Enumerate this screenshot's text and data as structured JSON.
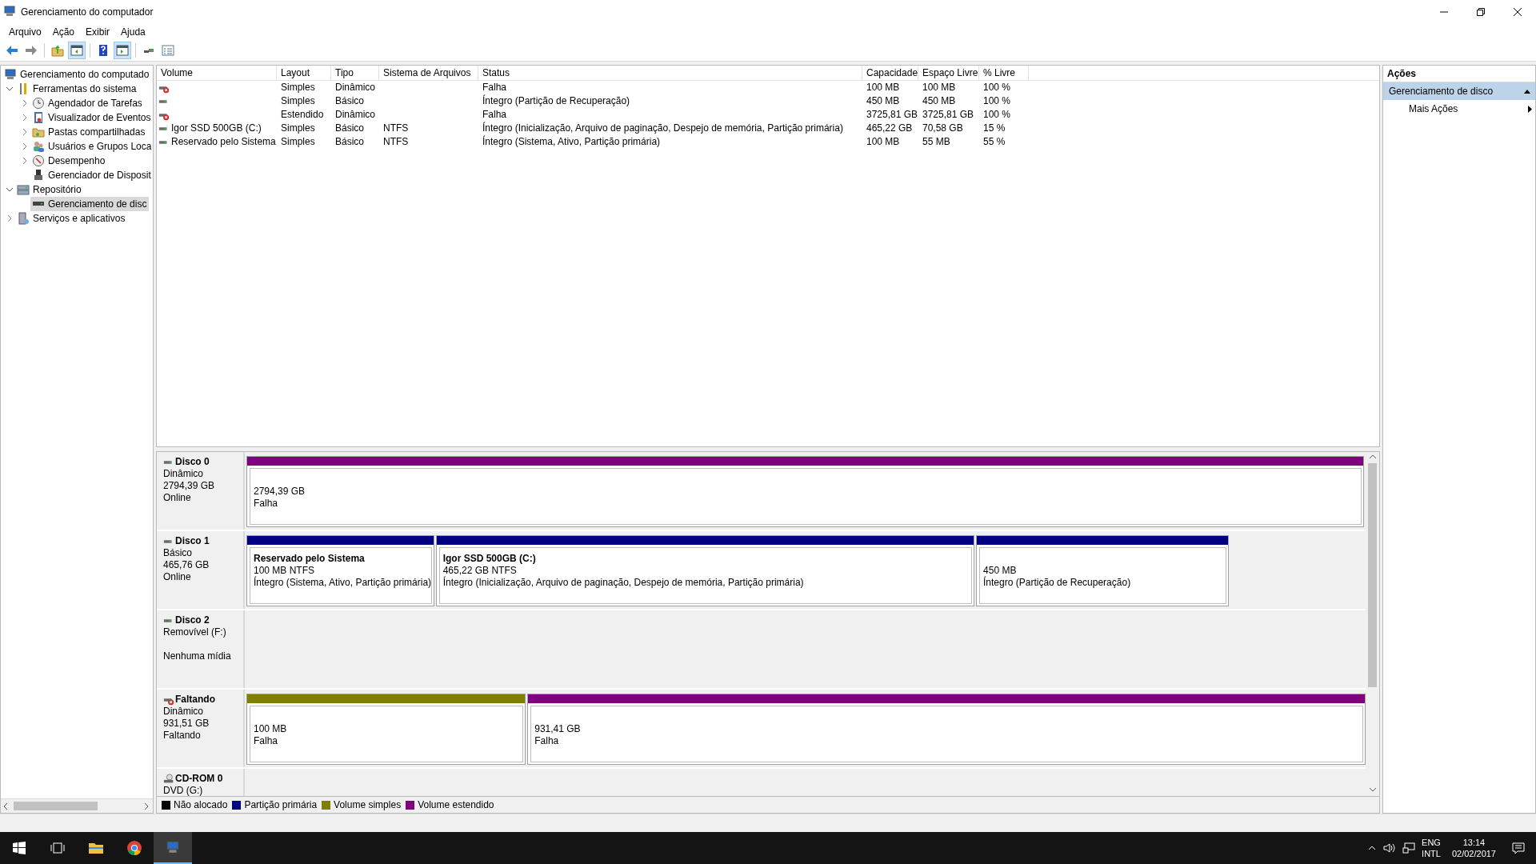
{
  "window": {
    "title": "Gerenciamento do computador"
  },
  "menu": [
    {
      "label": "Arquivo"
    },
    {
      "label": "Ação"
    },
    {
      "label": "Exibir"
    },
    {
      "label": "Ajuda"
    }
  ],
  "toolbar": [
    {
      "kind": "back",
      "pressed": false
    },
    {
      "kind": "forward",
      "pressed": false
    },
    {
      "kind": "up",
      "pressed": false
    },
    {
      "kind": "tree_pane",
      "pressed": true
    },
    {
      "kind": "help",
      "pressed": false
    },
    {
      "kind": "action_pane",
      "pressed": true
    },
    {
      "kind": "connect",
      "pressed": false
    },
    {
      "kind": "properties",
      "pressed": false
    }
  ],
  "tree": [
    {
      "label": "Gerenciamento do computado",
      "selected": false,
      "children": [
        {
          "label": "Ferramentas do sistema",
          "expanded": true,
          "selected": false,
          "children": [
            {
              "label": "Agendador de Tarefas",
              "expanded": false,
              "selected": false
            },
            {
              "label": "Visualizador de Eventos",
              "expanded": false,
              "selected": false
            },
            {
              "label": "Pastas compartilhadas",
              "expanded": false,
              "selected": false
            },
            {
              "label": "Usuários e Grupos Loca",
              "expanded": false,
              "selected": false
            },
            {
              "label": "Desempenho",
              "expanded": false,
              "selected": false
            },
            {
              "label": "Gerenciador de Disposit",
              "selected": false
            }
          ]
        },
        {
          "label": "Repositório",
          "expanded": true,
          "selected": false,
          "children": [
            {
              "label": "Gerenciamento de disc",
              "selected": true
            }
          ]
        },
        {
          "label": "Serviços e aplicativos",
          "expanded": false,
          "selected": false
        }
      ]
    }
  ],
  "volumes": {
    "columns": [
      "Volume",
      "Layout",
      "Tipo",
      "Sistema de Arquivos",
      "Status",
      "Capacidade",
      "Espaço Livre",
      "% Livre"
    ],
    "rows": [
      {
        "error": true,
        "layout": "Simples",
        "type": "Dinâmico",
        "status": "Falha",
        "capacity": "100 MB",
        "free": "100 MB",
        "pct": "100 %"
      },
      {
        "error": false,
        "layout": "Simples",
        "type": "Básico",
        "status": "Íntegro (Partição de Recuperação)",
        "capacity": "450 MB",
        "free": "450 MB",
        "pct": "100 %"
      },
      {
        "error": true,
        "layout": "Estendido",
        "type": "Dinâmico",
        "status": "Falha",
        "capacity": "3725,81 GB",
        "free": "3725,81 GB",
        "pct": "100 %"
      },
      {
        "error": false,
        "volume": "Igor SSD 500GB (C:)",
        "layout": "Simples",
        "type": "Básico",
        "fs": "NTFS",
        "status": "Íntegro (Inicialização, Arquivo de paginação, Despejo de memória, Partição primária)",
        "capacity": "465,22 GB",
        "free": "70,58 GB",
        "pct": "15 %"
      },
      {
        "error": false,
        "volume": "Reservado pelo Sistema",
        "layout": "Simples",
        "type": "Básico",
        "fs": "NTFS",
        "status": "Íntegro (Sistema, Ativo, Partição primária)",
        "capacity": "100 MB",
        "free": "55 MB",
        "pct": "55 %"
      }
    ]
  },
  "disks": [
    {
      "kind": "hdd",
      "name": "Disco 0",
      "type": "Dinâmico",
      "size": "2794,39 GB",
      "status": "Online",
      "partitions": [
        {
          "kind": "extended",
          "size": "2794,39 GB",
          "status": "Falha"
        }
      ]
    },
    {
      "kind": "hdd",
      "name": "Disco 1",
      "type": "Básico",
      "size": "465,76 GB",
      "status": "Online",
      "partitions": [
        {
          "kind": "primary",
          "name": "Reservado pelo Sistema",
          "size": "100 MB NTFS",
          "status": "Íntegro (Sistema, Ativo, Partição primária)"
        },
        {
          "kind": "primary",
          "name": "Igor SSD 500GB  (C:)",
          "size": "465,22 GB NTFS",
          "status": "Íntegro (Inicialização, Arquivo de paginação, Despejo de memória, Partição primária)"
        },
        {
          "kind": "primary",
          "size": "450 MB",
          "status": "Íntegro (Partição de Recuperação)"
        }
      ]
    },
    {
      "kind": "hdd",
      "name": "Disco 2",
      "type": "Removível (F:)",
      "status": "Nenhuma mídia"
    },
    {
      "kind": "missing",
      "name": "Faltando",
      "type": "Dinâmico",
      "size": "931,51 GB",
      "status": "Faltando",
      "partitions": [
        {
          "kind": "simple",
          "size": "100 MB",
          "status": "Falha"
        },
        {
          "kind": "extended",
          "size": "931,41 GB",
          "status": "Falha"
        }
      ]
    },
    {
      "kind": "cdrom",
      "name": "CD-ROM 0",
      "type": "DVD (G:)"
    }
  ],
  "legend": [
    {
      "label": "Não alocado",
      "color": "#000000"
    },
    {
      "label": "Partição primária",
      "color": "#000080"
    },
    {
      "label": "Volume simples",
      "color": "#808000"
    },
    {
      "label": "Volume estendido",
      "color": "#800080"
    }
  ],
  "actions": {
    "title": "Ações",
    "section": {
      "label": "Gerenciamento de disco",
      "expanded": true
    },
    "items": [
      {
        "label": "Mais Ações"
      }
    ]
  },
  "taskbar": {
    "apps": [
      {
        "kind": "start",
        "active": false
      },
      {
        "kind": "taskview",
        "active": false
      },
      {
        "kind": "explorer",
        "active": false
      },
      {
        "kind": "browser",
        "active": false
      },
      {
        "kind": "compmgmt",
        "active": true
      }
    ],
    "language": [
      "ENG",
      "INTL"
    ],
    "time": "13:14",
    "date": "02/02/2017"
  }
}
